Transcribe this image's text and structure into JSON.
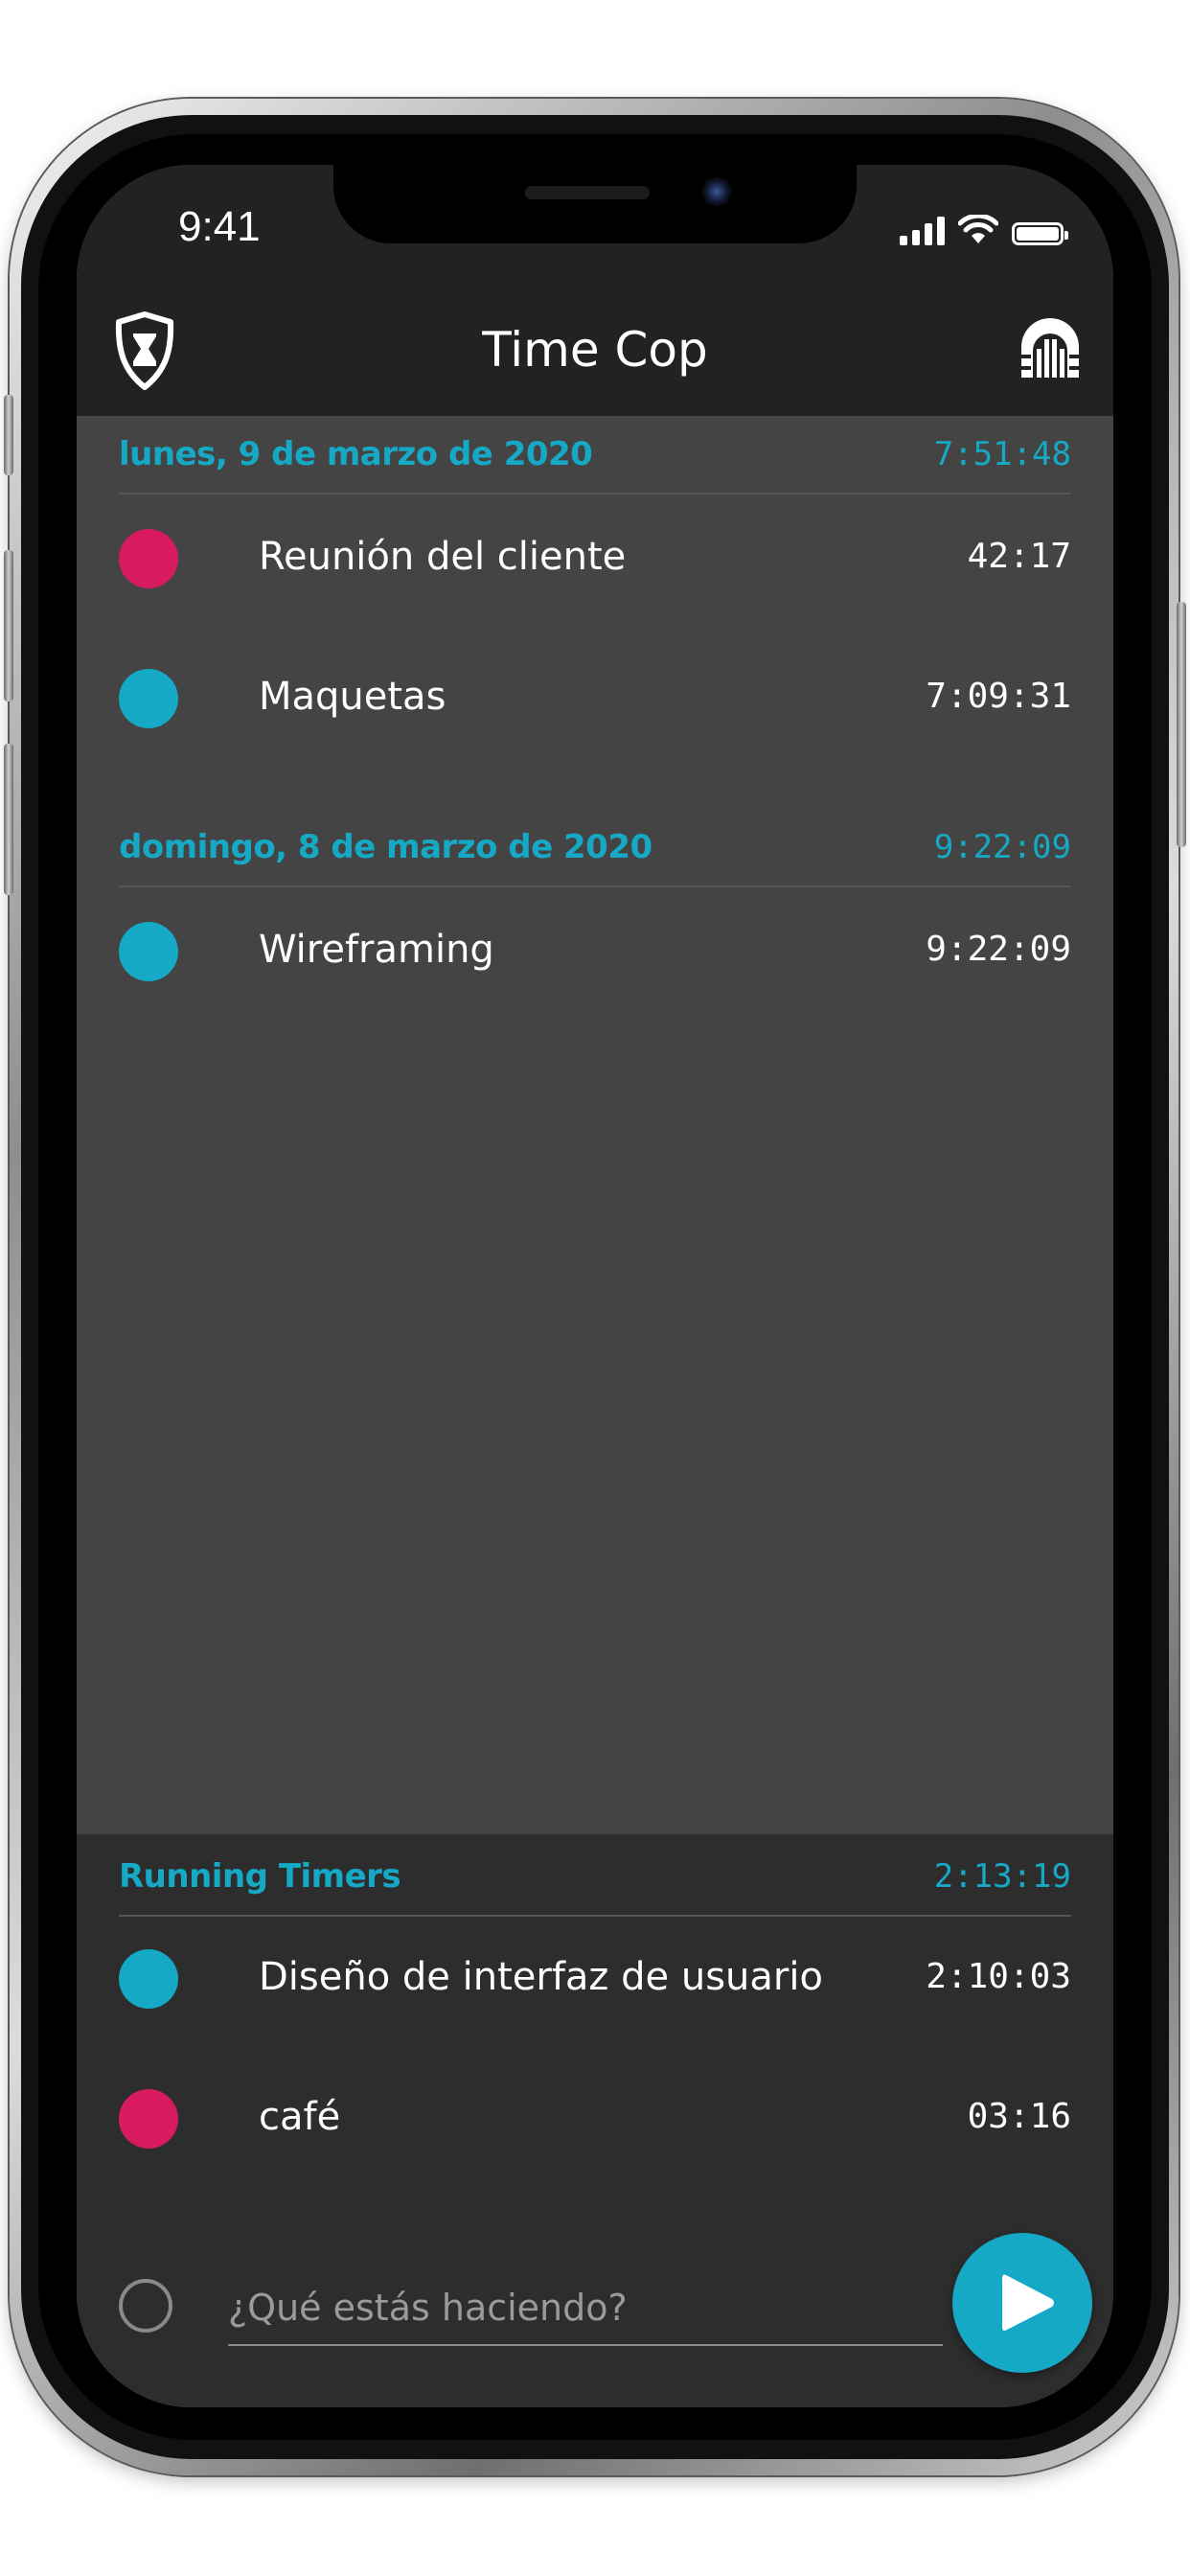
{
  "status_bar": {
    "time": "9:41",
    "icons": [
      "cellular-signal-icon",
      "wifi-icon",
      "battery-icon"
    ]
  },
  "app_bar": {
    "title": "Time Cop",
    "left_icon": "shield-hourglass-icon",
    "right_icon": "archive-door-icon"
  },
  "days": [
    {
      "date_label": "lunes, 9 de marzo de 2020",
      "total": "7:51:48",
      "entries": [
        {
          "description": "Reunión del cliente",
          "duration": "42:17",
          "color": "#d81b60"
        },
        {
          "description": "Maquetas",
          "duration": "7:09:31",
          "color": "#16a9c6"
        }
      ]
    },
    {
      "date_label": "domingo, 8 de marzo de 2020",
      "total": "9:22:09",
      "entries": [
        {
          "description": "Wireframing",
          "duration": "9:22:09",
          "color": "#16a9c6"
        }
      ]
    }
  ],
  "running": {
    "label": "Running Timers",
    "total": "2:13:19",
    "entries": [
      {
        "description": "Diseño de interfaz de usuario",
        "duration": "2:10:03",
        "color": "#16a9c6"
      },
      {
        "description": "café",
        "duration": "03:16",
        "color": "#d81b60"
      }
    ]
  },
  "composer": {
    "placeholder": "¿Qué estás haciendo?",
    "value": "",
    "start_icon": "play-icon"
  },
  "colors": {
    "accent": "#16a9c6",
    "pink": "#d81b60",
    "app_bar": "#222222",
    "list_bg": "#444444",
    "running_bg": "#2d2d2d"
  }
}
